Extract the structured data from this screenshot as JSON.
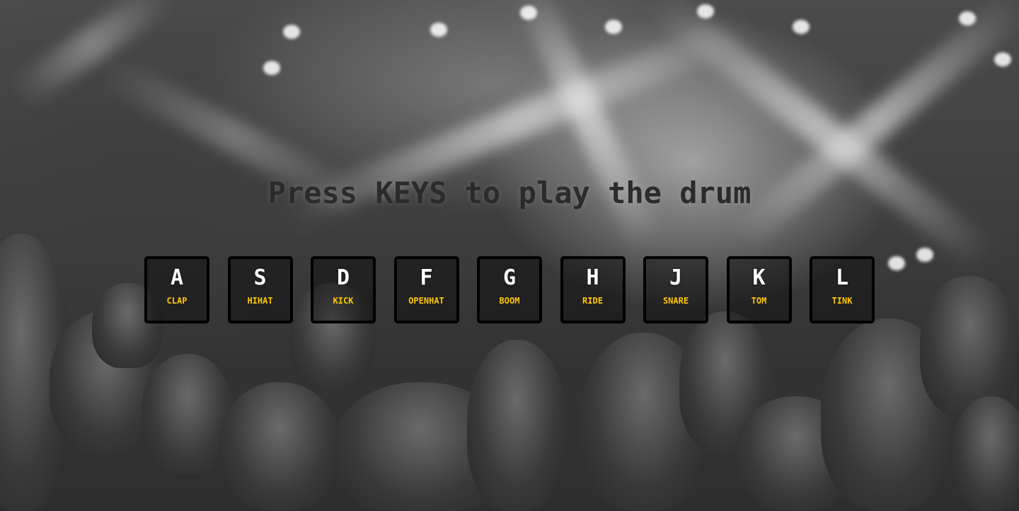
{
  "page": {
    "title": "Press KEYS to play the drum"
  },
  "keys": [
    {
      "key": "A",
      "sound": "CLAP"
    },
    {
      "key": "S",
      "sound": "HIHAT"
    },
    {
      "key": "D",
      "sound": "KICK"
    },
    {
      "key": "F",
      "sound": "OPENHAT"
    },
    {
      "key": "G",
      "sound": "BOOM"
    },
    {
      "key": "H",
      "sound": "RIDE"
    },
    {
      "key": "J",
      "sound": "SNARE"
    },
    {
      "key": "K",
      "sound": "TOM"
    },
    {
      "key": "L",
      "sound": "TINK"
    }
  ],
  "colors": {
    "title": "#2b2b2b",
    "key_letter": "#ffffff",
    "sound_label": "#ffc600",
    "key_border": "#000000"
  }
}
